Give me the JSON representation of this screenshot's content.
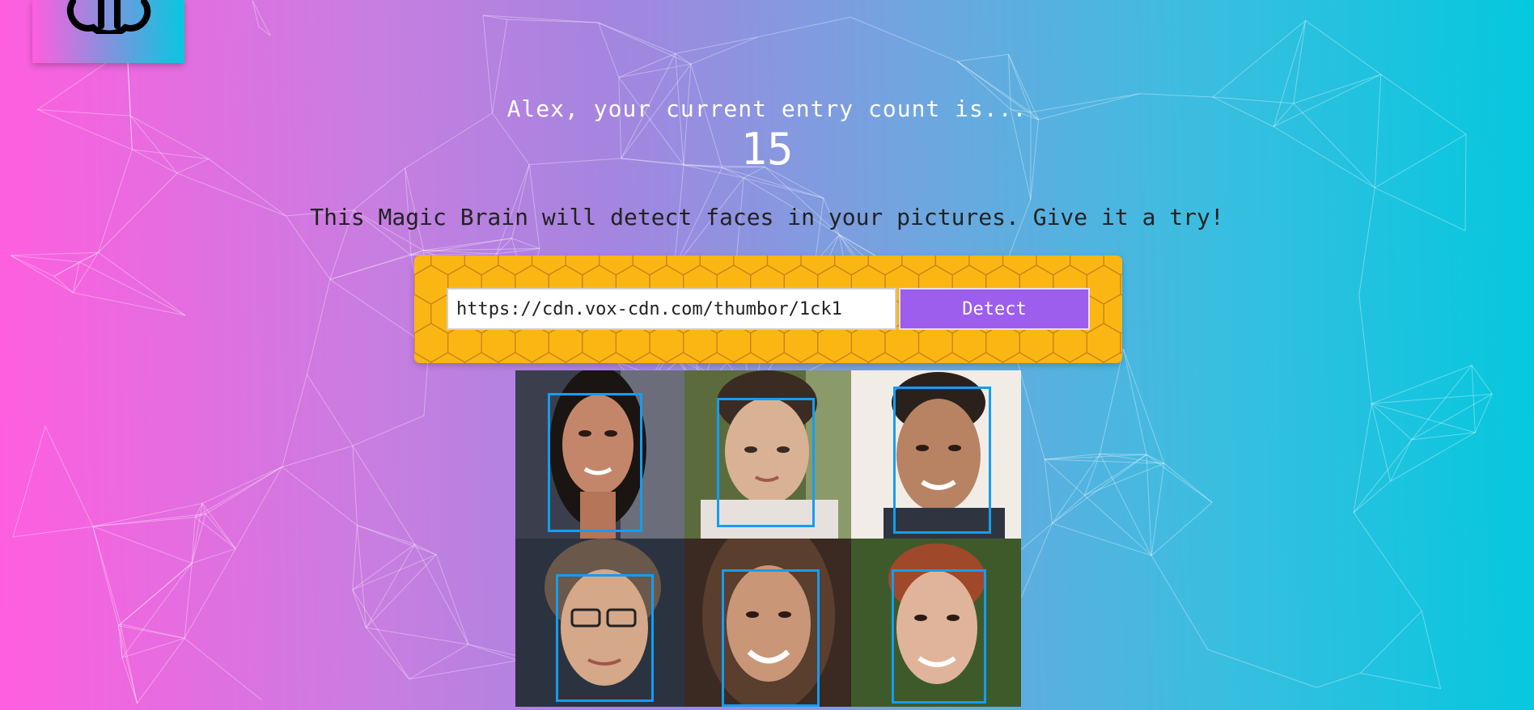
{
  "greeting": "Alex, your current entry count is...",
  "entry_count": "15",
  "tagline": "This Magic Brain will detect faces in your pictures. Give it a try!",
  "form": {
    "url_value": "https://cdn.vox-cdn.com/thumbor/1ck1",
    "detect_label": "Detect"
  },
  "colors": {
    "gradient_left": "#ff5edf",
    "gradient_right": "#04c8de",
    "panel": "#fbb613",
    "button": "#9d5ded",
    "face_box": "#149df2"
  },
  "faces_detected": 6
}
